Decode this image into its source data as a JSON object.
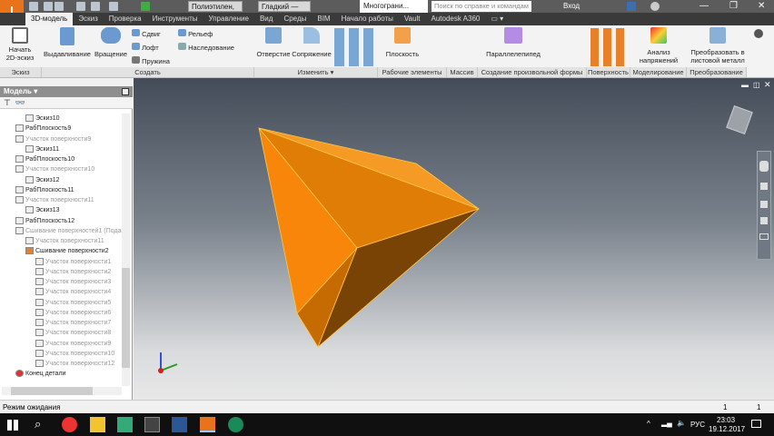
{
  "title_bar": {
    "app_button": "I",
    "material": "Полиэтилен,",
    "appearance": "Гладкий —",
    "document_tab": "Многограни...",
    "search_placeholder": "Поиск по справке и командам",
    "sign_in": "Вход"
  },
  "tabs": [
    "3D-модель",
    "Эскиз",
    "Проверка",
    "Инструменты",
    "Управление",
    "Вид",
    "Среды",
    "BIM",
    "Начало работы",
    "Vault",
    "Autodesk A360"
  ],
  "ribbon": {
    "buttons": {
      "start_sketch": "Начать 2D-эскиз",
      "extrude": "Выдавливание",
      "revolve": "Вращение",
      "sweep": "Сдвиг",
      "loft": "Лофт",
      "coil": "Пружина",
      "emboss": "Рельеф",
      "derive": "Наследование",
      "hole": "Отверстие",
      "fillet": "Сопряжение",
      "plane": "Плоскость",
      "box": "Параллелепипед",
      "stress": "Анализ напряжений",
      "sheetmetal": "Преобразовать в листовой металл"
    },
    "panels": [
      "Эскиз",
      "Создать",
      "Изменить ▾",
      "Рабочие элементы",
      "Массив",
      "Создание произвольной формы",
      "Поверхность",
      "Моделирование",
      "Преобразование"
    ]
  },
  "browser": {
    "title": "Модель ▾",
    "items": [
      {
        "label": "Эскиз10",
        "level": 2,
        "dim": false
      },
      {
        "label": "РабПлоскость9",
        "level": 1,
        "dim": false
      },
      {
        "label": "Участок поверхности9",
        "level": 1,
        "dim": true
      },
      {
        "label": "Эскиз11",
        "level": 2,
        "dim": false
      },
      {
        "label": "РабПлоскость10",
        "level": 1,
        "dim": false
      },
      {
        "label": "Участок поверхности10",
        "level": 1,
        "dim": true
      },
      {
        "label": "Эскиз12",
        "level": 2,
        "dim": false
      },
      {
        "label": "РабПлоскость11",
        "level": 1,
        "dim": false
      },
      {
        "label": "Участок поверхности11",
        "level": 1,
        "dim": true
      },
      {
        "label": "Эскиз13",
        "level": 2,
        "dim": false
      },
      {
        "label": "РабПлоскость12",
        "level": 1,
        "dim": false
      },
      {
        "label": "Сшивание поверхностей1 (Подав",
        "level": 1,
        "dim": true
      },
      {
        "label": "Участок поверхности11",
        "level": 2,
        "dim": true
      },
      {
        "label": "Сшивание поверхности2",
        "level": 2,
        "dim": false
      },
      {
        "label": "Участок поверхности1",
        "level": 3,
        "dim": true
      },
      {
        "label": "Участок поверхности2",
        "level": 3,
        "dim": true
      },
      {
        "label": "Участок поверхности3",
        "level": 3,
        "dim": true
      },
      {
        "label": "Участок поверхности4",
        "level": 3,
        "dim": true
      },
      {
        "label": "Участок поверхности5",
        "level": 3,
        "dim": true
      },
      {
        "label": "Участок поверхности6",
        "level": 3,
        "dim": true
      },
      {
        "label": "Участок поверхности7",
        "level": 3,
        "dim": true
      },
      {
        "label": "Участок поверхности8",
        "level": 3,
        "dim": true
      },
      {
        "label": "Участок поверхности9",
        "level": 3,
        "dim": true
      },
      {
        "label": "Участок поверхности10",
        "level": 3,
        "dim": true
      },
      {
        "label": "Участок поверхности12",
        "level": 3,
        "dim": true
      },
      {
        "label": "Конец детали",
        "level": 1,
        "dim": false
      }
    ]
  },
  "status": {
    "text": "Режим ожидания",
    "count1": "1",
    "count2": "1"
  },
  "taskbar": {
    "lang": "РУС",
    "time": "23:03",
    "date": "19.12.2017"
  },
  "colors": {
    "accent": "#e8731a",
    "model": "#f28a0c"
  }
}
